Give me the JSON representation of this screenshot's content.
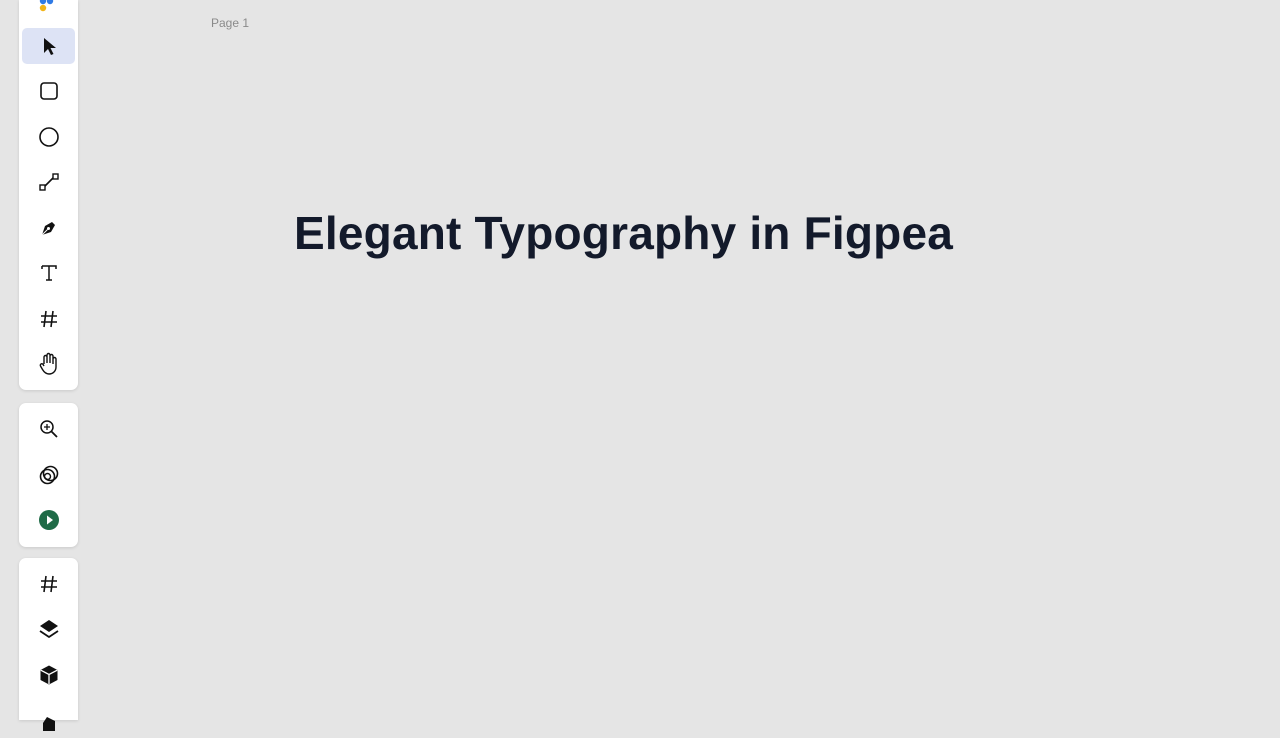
{
  "canvas": {
    "page_label": "Page 1",
    "headline": "Elegant Typography in Figpea"
  },
  "toolbar_main": {
    "tools": [
      {
        "name": "select-tool",
        "icon": "cursor-arrow-icon",
        "active": true
      },
      {
        "name": "rectangle-tool",
        "icon": "rounded-square-icon",
        "active": false
      },
      {
        "name": "ellipse-tool",
        "icon": "circle-icon",
        "active": false
      },
      {
        "name": "line-tool",
        "icon": "line-icon",
        "active": false
      },
      {
        "name": "pen-tool",
        "icon": "pen-nib-icon",
        "active": false
      },
      {
        "name": "text-tool",
        "icon": "text-t-icon",
        "active": false
      },
      {
        "name": "frame-tool",
        "icon": "hash-icon",
        "active": false
      },
      {
        "name": "hand-tool",
        "icon": "hand-icon",
        "active": false
      }
    ]
  },
  "toolbar_secondary": {
    "tools": [
      {
        "name": "zoom-tool",
        "icon": "zoom-in-icon"
      },
      {
        "name": "boolean-tool",
        "icon": "overlapping-circles-icon"
      },
      {
        "name": "present-tool",
        "icon": "play-circle-icon"
      }
    ]
  },
  "toolbar_panels": {
    "tools": [
      {
        "name": "frames-panel",
        "icon": "hash-icon"
      },
      {
        "name": "layers-panel",
        "icon": "layers-icon"
      },
      {
        "name": "components-panel",
        "icon": "cube-icon"
      },
      {
        "name": "assets-panel",
        "icon": "box-partial-icon"
      }
    ]
  },
  "colors": {
    "canvas_bg": "#e5e5e5",
    "headline": "#131a2b",
    "active_tool_bg": "#dde3f5",
    "present_green": "#1f6b47"
  }
}
